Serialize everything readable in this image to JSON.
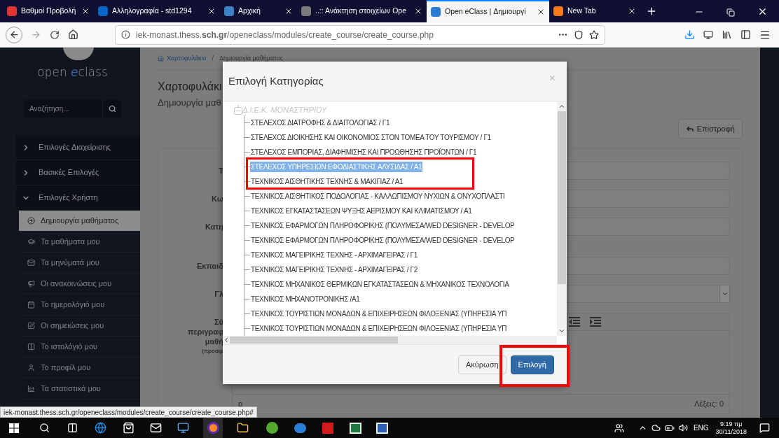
{
  "browser": {
    "tabs": [
      {
        "title": "Βαθμοί Προβολή",
        "selected": false
      },
      {
        "title": "Αλληλογραφία - std1294",
        "selected": false
      },
      {
        "title": "Αρχική",
        "selected": false
      },
      {
        "title": "..:: Ανάκτηση στοιχείων Ope",
        "selected": false
      },
      {
        "title": "Open eClass | Δημιουργί",
        "selected": true
      },
      {
        "title": "New Tab",
        "selected": false
      }
    ],
    "url": "iek-monast.thess.**sch.gr**/openeclass/modules/create_course/create_course.php",
    "status_url": "iek-monast.thess.sch.gr/openeclass/modules/create_course/create_course.php#"
  },
  "sidebar": {
    "logo": [
      {
        "text": "open ",
        "accent": false
      },
      {
        "text": "e",
        "accent": true
      },
      {
        "text": "class",
        "accent": false
      }
    ],
    "search": {
      "placeholder": "Αναζήτηση..."
    },
    "groups": [
      {
        "label": "Επιλογές Διαχείρισης",
        "expanded": false
      },
      {
        "label": "Βασικές Επιλογές",
        "expanded": false
      },
      {
        "label": "Επιλογές Χρήστη",
        "expanded": true,
        "items": [
          {
            "label": "Δημιουργία μαθήματος",
            "selected": true
          },
          {
            "label": "Τα μαθήματα μου",
            "selected": false
          },
          {
            "label": "Τα μηνύματά μου",
            "selected": false
          },
          {
            "label": "Οι ανακοινώσεις μου",
            "selected": false
          },
          {
            "label": "Το ημερολόγιό μου",
            "selected": false
          },
          {
            "label": "Οι σημειώσεις μου",
            "selected": false
          },
          {
            "label": "Το ιστολόγιό μου",
            "selected": false
          },
          {
            "label": "Το προφίλ μου",
            "selected": false
          },
          {
            "label": "Τα στατιστικά μου",
            "selected": false
          }
        ]
      }
    ]
  },
  "breadcrumb": [
    "Χαρτοφυλάκιο",
    "Δημιουργία μαθήματος"
  ],
  "breadcrumb_separator": "/",
  "page_title": "Χαρτοφυλάκι",
  "page_subtitle": "Δημιουργία μαθ",
  "back_button": "Επιστροφή",
  "form": [
    {
      "kind": "input",
      "lines": [
        "Τ"
      ]
    },
    {
      "kind": "input",
      "lines": [
        "Κω"
      ]
    },
    {
      "kind": "input",
      "lines": [
        "Κατη"
      ]
    },
    {
      "kind": "input",
      "lines": [
        "Εκπαιδ"
      ]
    },
    {
      "kind": "select",
      "lines": [
        "Γλ"
      ]
    },
    {
      "kind": "editor",
      "lines": [
        "Σύ",
        "περιγραφ",
        "μαθή",
        "(προαιρ"
      ],
      "path": "p",
      "word_count": "Λέξεις: 0"
    }
  ],
  "dialog": {
    "title": "Επιλογή Κατηγορίας",
    "close": "×",
    "root": "Δ.Ι.Ε.Κ. ΜΟΝΑΣΤΗΡΙΟΥ",
    "items": [
      {
        "label": "ΣΤΕΛΕΧΟΣ ΔΙΑΤΡΟΦΗΣ & ΔΙΑΙΤΟΛΟΓΙΑΣ / Γ1",
        "selected": false
      },
      {
        "label": "ΣΤΕΛΕΧΟΣ ΔΙΟΙΚΗΣΗΣ ΚΑΙ ΟΙΚΟΝΟΜΙΟΣ ΣΤΟΝ ΤΟΜΕΑ ΤΟΥ ΤΟΥΡΙΣΜΟΥ / Γ1",
        "selected": false
      },
      {
        "label": "ΣΤΕΛΕΧΟΣ ΕΜΠΟΡΙΑΣ, ΔΙΑΦΗΜΙΣΗΣ ΚΑΙ ΠΡΟΩΘΗΣΗΣ ΠΡΟΪΟΝΤΩΝ / Γ1",
        "selected": false
      },
      {
        "label": "ΣΤΕΛΕΧΟΣ ΥΠΗΡΕΣΙΩΝ ΕΦΟΔΙΑΣΤΙΚΗΣ ΑΛΥΣΙΔΑΣ / Α1",
        "selected": true
      },
      {
        "label": "ΤΕΧΝΙΚΟΣ ΑΙΣΘΗΤΙΚΗΣ ΤΕΧΝΗΣ & ΜΑΚΙΓΙΑΖ / Α1",
        "selected": false
      },
      {
        "label": "ΤΕΧΝΙΚΟΣ ΑΙΣΘΗΤΙΚΟΣ ΠΟΔΟΛΟΓΙΑΣ - ΚΑΛΛΩΠΙΣΜΟΥ ΝΥΧΙΩΝ & ΟΝΥΧΟΠΛΑΣΤΙ",
        "selected": false
      },
      {
        "label": "ΤΕΧΝΙΚΟΣ ΕΓΚΑΤΑΣΤΑΣΕΩΝ ΨΥΞΗΣ ΑΕΡΙΣΜΟΥ ΚΑΙ ΚΛΙΜΑΤΙΣΜΟΥ / Α1",
        "selected": false
      },
      {
        "label": "ΤΕΧΝΙΚΟΣ ΕΦΑΡΜΟΓΩΝ ΠΛΗΡΟΦΟΡΙΚΗΣ (ΠΟΛΥΜΕΣΑ/WED DESIGNER - DEVELOP",
        "selected": false
      },
      {
        "label": "ΤΕΧΝΙΚΟΣ ΕΦΑΡΜΟΓΩΝ ΠΛΗΡΟΦΟΡΙΚΗΣ (ΠΟΛΥΜΕΣΑ/WED DESIGNER - DEVELOP",
        "selected": false
      },
      {
        "label": "ΤΕΧΝΙΚΟΣ ΜΑΓΕΙΡΙΚΗΣ ΤΕΧΝΗΣ - ΑΡΧΙΜΑΓΕΙΡΑΣ / Γ1",
        "selected": false
      },
      {
        "label": "ΤΕΧΝΙΚΟΣ ΜΑΓΕΙΡΙΚΗΣ ΤΕΧΝΗΣ - ΑΡΧΙΜΑΓΕΙΡΑΣ / Γ2",
        "selected": false
      },
      {
        "label": "ΤΕΧΝΙΚΟΣ ΜΗΧΑΝΙΚΟΣ ΘΕΡΜΙΚΩΝ ΕΓΚΑΤΑΣΤΑΣΕΩΝ & ΜΗΧΑΝΙΚΟΣ ΤΕΧΝΟΛΟΓΙΑ",
        "selected": false
      },
      {
        "label": "ΤΕΧΝΙΚΟΣ ΜΗΧΑΝΟΤΡΟΝΙΚΗΣ /Α1",
        "selected": false
      },
      {
        "label": "ΤΕΧΝΙΚΟΣ ΤΟΥΡΙΣΤΙΩΝ ΜΟΝΑΔΩΝ & ΕΠΙΧΕΙΡΗΣΕΩΝ ΦΙΛΟΞΕΝΙΑΣ (ΥΠΗΡΕΣΙΑ ΥΠ",
        "selected": false
      },
      {
        "label": "ΤΕΧΝΙΚΟΣ ΤΟΥΡΙΣΤΙΩΝ ΜΟΝΑΔΩΝ & ΕΠΙΧΕΙΡΗΣΕΩΝ ΦΙΛΟΞΕΝΙΑΣ (ΥΠΗΡΕΣΙΑ ΥΠ",
        "selected": false
      }
    ],
    "buttons": [
      {
        "kind": "cancel",
        "label": "Ακύρωση"
      },
      {
        "kind": "primary",
        "label": "Επιλογή"
      }
    ]
  },
  "taskbar": {
    "language": "ENG",
    "time": "9:19 πμ",
    "date": "30/11/2018"
  }
}
